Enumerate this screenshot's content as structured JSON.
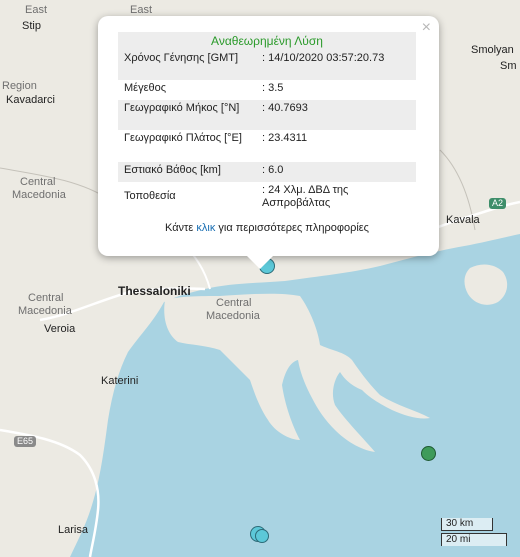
{
  "map": {
    "labels": {
      "east1": "East",
      "east2": "East",
      "stip": "Stip",
      "region1": "Region",
      "kavadarci": "Kavadarci",
      "smolyan": "Smolyan",
      "sm_partial": "Sm",
      "central1": "Central",
      "macedonia1": "Macedonia",
      "central2": "Central",
      "macedonia2": "Macedonia",
      "central3": "Central",
      "macedonia3": "Macedonia",
      "thessaloniki": "Thessaloniki",
      "veroia": "Veroia",
      "katerini": "Katerini",
      "kavala": "Kavala",
      "larisa": "Larisa"
    },
    "shields": {
      "a2": "A2",
      "e65": "E65"
    },
    "colors": {
      "land": "#eceae3",
      "water": "#a9d3e2",
      "quake_primary": "#5cc8d8",
      "quake_other": "#3e9b5a"
    }
  },
  "popup": {
    "title": "Αναθεωρημένη Λύση",
    "close_icon": "×",
    "rows": [
      {
        "label": "Χρόνος Γένησης [GMT]",
        "value": ": 14/10/2020 03:57:20.73"
      },
      {
        "label": "Μέγεθος",
        "value": ": 3.5"
      },
      {
        "label": "Γεωγραφικό Μήκος [°N]",
        "value": ": 40.7693"
      },
      {
        "label": "Γεωγραφικό Πλάτος [°E]",
        "value": ": 23.4311"
      },
      {
        "label": "Εστιακό Βάθος [km]",
        "value": ": 6.0"
      },
      {
        "label": "Τοποθεσία",
        "value": ": 24 Χλμ. ΔΒΔ της Ασπροβάλτας"
      }
    ],
    "footer_before": "Κάντε ",
    "footer_link": "κλικ",
    "footer_after": " για περισσότερες πληροφορίες"
  },
  "scale": {
    "km": "30 km",
    "mi": "20 mi"
  }
}
